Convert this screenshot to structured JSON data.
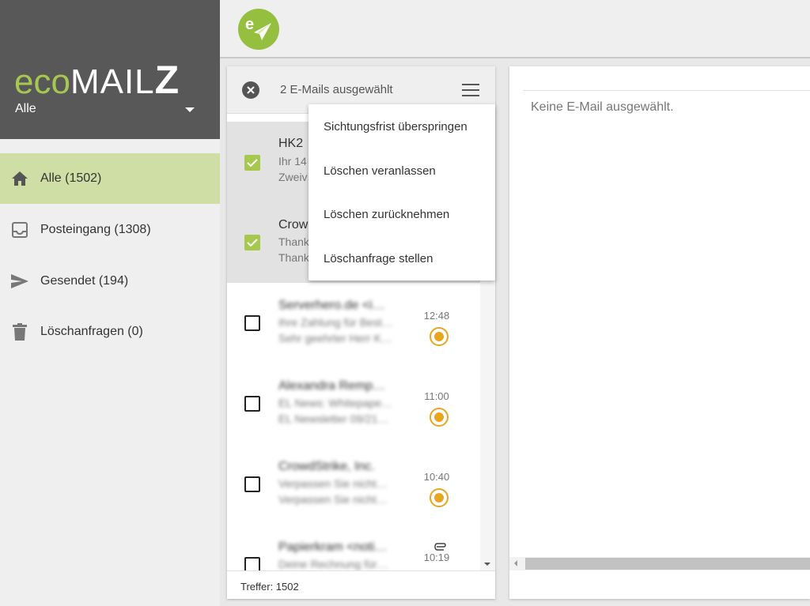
{
  "brand": {
    "eco": "eco",
    "mail": "MAIL",
    "z": "Z",
    "account_selector": "Alle"
  },
  "sidebar": {
    "items": [
      {
        "label": "Alle (1502)",
        "icon": "home-icon",
        "active": true
      },
      {
        "label": "Posteingang (1308)",
        "icon": "inbox-icon",
        "active": false
      },
      {
        "label": "Gesendet (194)",
        "icon": "send-icon",
        "active": false
      },
      {
        "label": "Löschanfragen (0)",
        "icon": "trash-icon",
        "active": false
      }
    ]
  },
  "list": {
    "selection_label": "2 E-Mails ausgewählt",
    "rows": [
      {
        "from": "HK2",
        "subject": "Ihr 14",
        "preview": "Zweiv",
        "checked": true
      },
      {
        "from": "Crow",
        "subject": "Thank",
        "preview": "Thank",
        "checked": true
      },
      {
        "from": "Serverhero.de <i…",
        "subject": "Ihre Zahlung für Best…",
        "preview": "Sehr geehrter Herr K…",
        "time": "12:48",
        "checked": false
      },
      {
        "from": "Alexandra Remp…",
        "subject": "EL News: Whitepape…",
        "preview": "EL Newsletter 09/21…",
        "time": "11:00",
        "checked": false
      },
      {
        "from": "CrowdStrike, Inc.",
        "subject": "Verpassen Sie nicht…",
        "preview": "Verpassen Sie nicht…",
        "time": "10:40",
        "checked": false
      },
      {
        "from": "Papierkram <noti…",
        "subject": "Deine Rechnung für…",
        "preview": "",
        "time": "10:19",
        "checked": false,
        "attachment": true
      }
    ],
    "footer": "Treffer: 1502"
  },
  "menu": {
    "items": [
      "Sichtungsfrist überspringen",
      "Löschen veranlassen",
      "Löschen zurücknehmen",
      "Löschanfrage stellen"
    ]
  },
  "preview": {
    "empty_text": "Keine E-Mail ausgewählt."
  },
  "colors": {
    "brand_green": "#a7c84f",
    "status_orange": "#e8a520",
    "sidebar_header": "#585858",
    "active_nav": "#cfdea4"
  }
}
